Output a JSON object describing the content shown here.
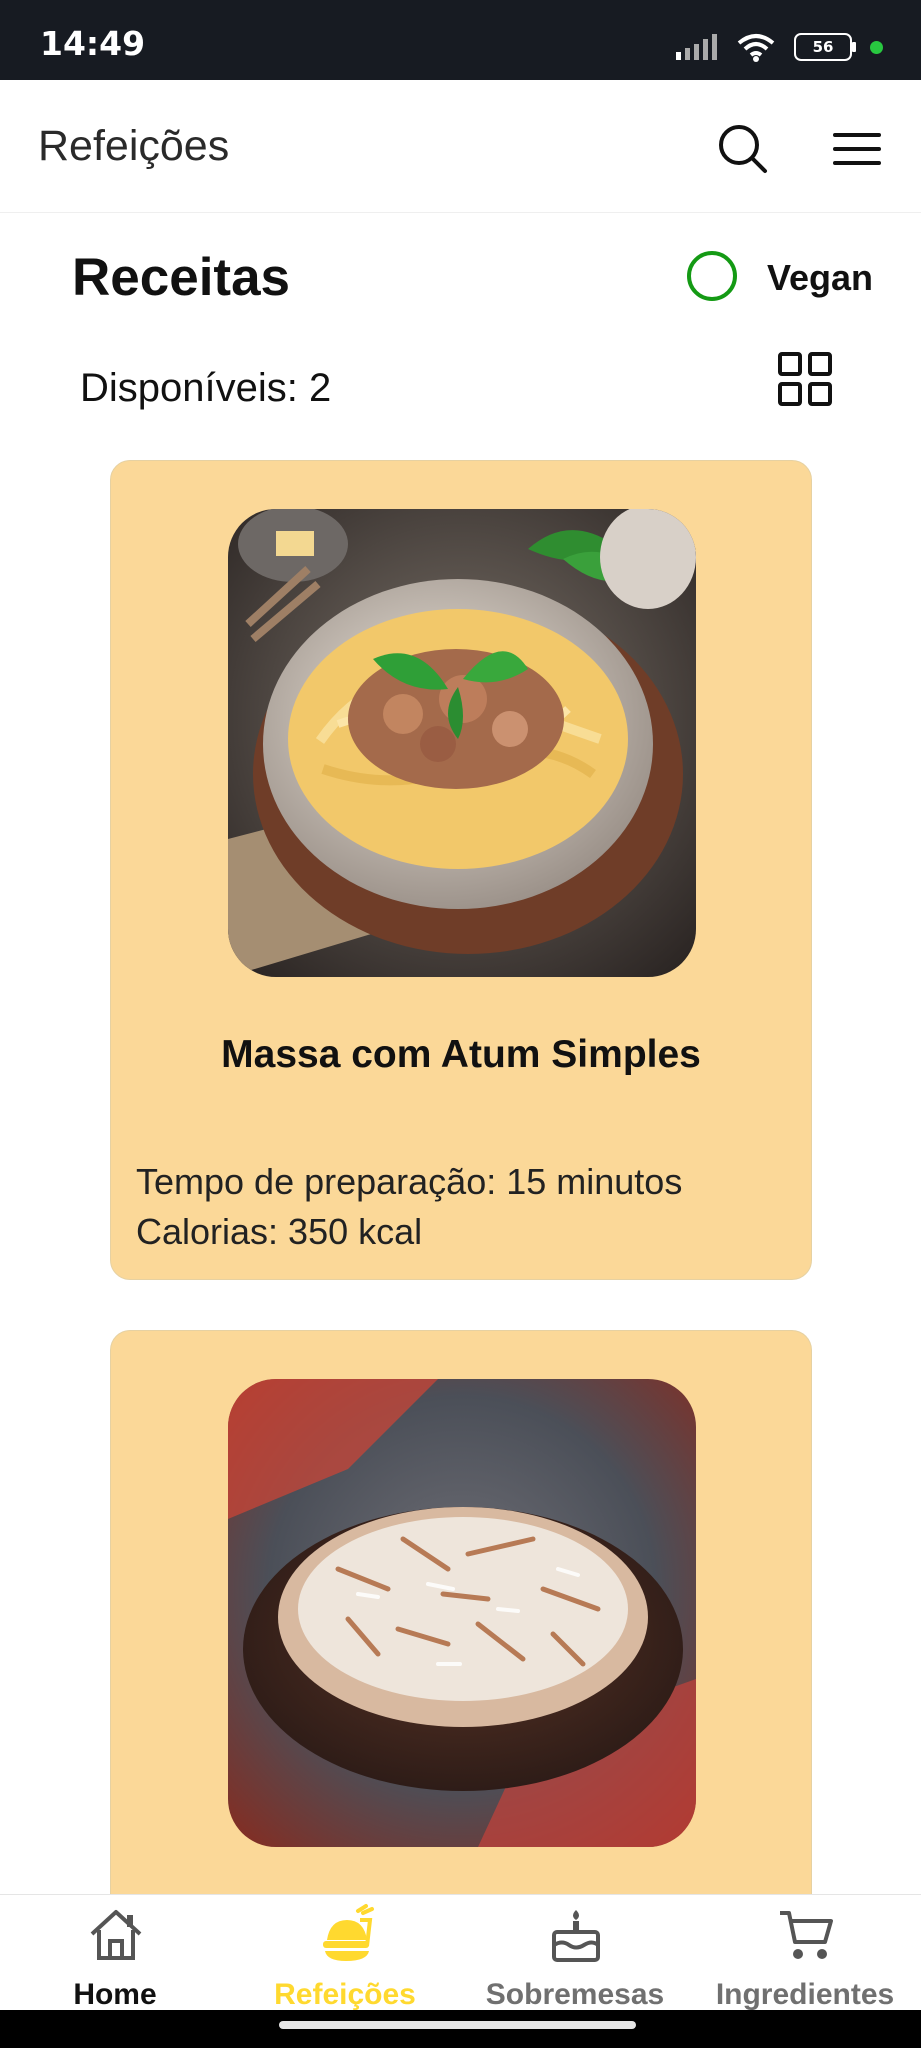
{
  "status": {
    "time": "14:49",
    "battery": "56"
  },
  "header": {
    "title": "Refeições",
    "search_icon": "search-icon",
    "menu_icon": "hamburger-menu-icon"
  },
  "filters": {
    "section_title": "Receitas",
    "vegan_label": "Vegan",
    "vegan_color": "#149a14",
    "available": "Disponíveis: 2",
    "view_icon": "grid-icon"
  },
  "recipes": [
    {
      "title": "Massa com Atum Simples",
      "time": "Tempo de preparação: 15 minutos",
      "calories": "Calorias: 350 kcal",
      "image": "pasta-with-tuna-image"
    },
    {
      "image": "rice-with-vermicelli-image"
    }
  ],
  "nav": [
    {
      "label": "Home",
      "icon": "home-icon"
    },
    {
      "label": "Refeições",
      "icon": "meal-icon",
      "active_color": "#ffd92f"
    },
    {
      "label": "Sobremesas",
      "icon": "cake-icon"
    },
    {
      "label": "Ingredientes",
      "icon": "cart-icon"
    }
  ]
}
